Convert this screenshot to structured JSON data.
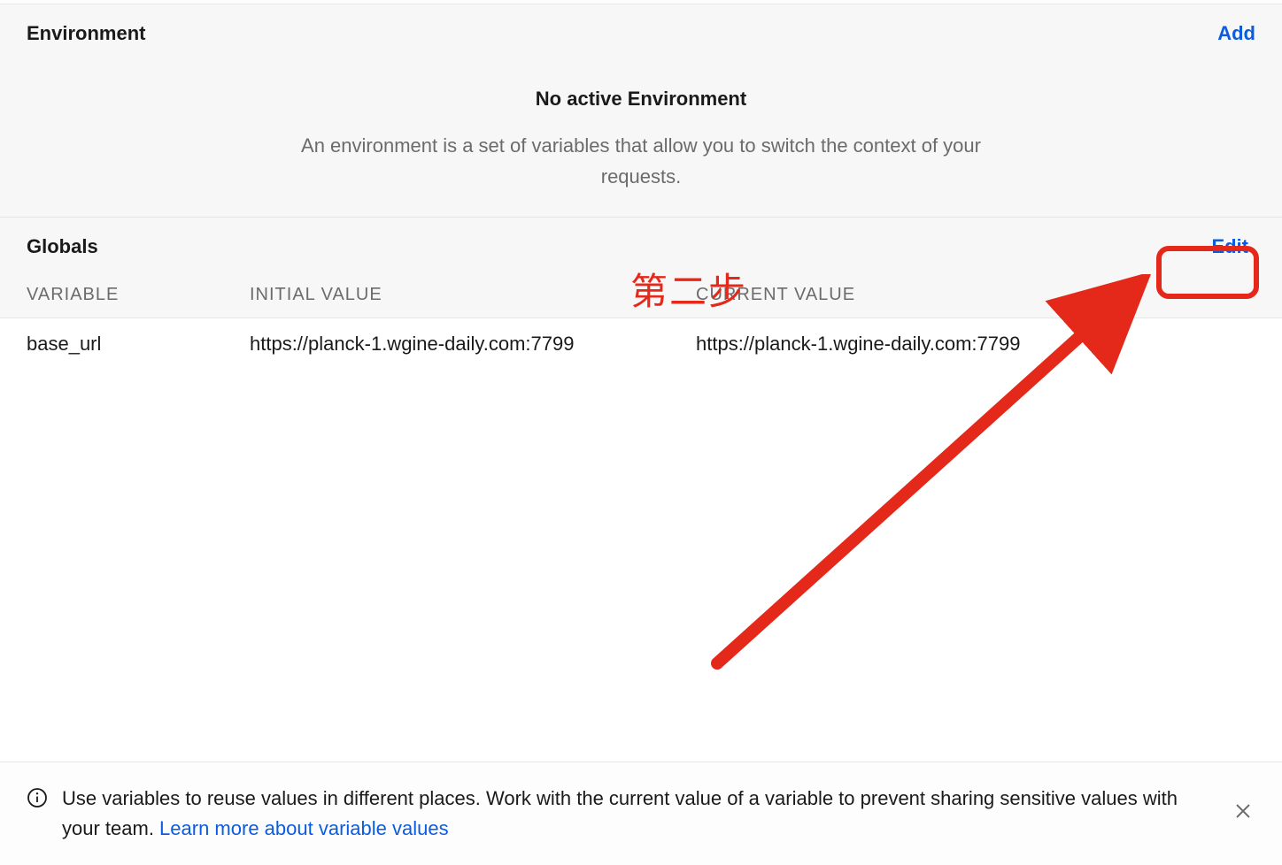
{
  "environment": {
    "title": "Environment",
    "add_label": "Add",
    "empty_title": "No active Environment",
    "empty_desc": "An environment is a set of variables that allow you to switch the context of your requests."
  },
  "globals": {
    "title": "Globals",
    "edit_label": "Edit",
    "columns": {
      "variable": "VARIABLE",
      "initial": "INITIAL VALUE",
      "current": "CURRENT VALUE"
    },
    "rows": [
      {
        "variable": "base_url",
        "initial": "https://planck-1.wgine-daily.com:7799",
        "current": "https://planck-1.wgine-daily.com:7799"
      }
    ]
  },
  "tip": {
    "text": "Use variables to reuse values in different places. Work with the current value of a variable to prevent sharing sensitive values with your team. ",
    "link": "Learn more about variable values"
  },
  "annotation": {
    "label": "第二步"
  }
}
